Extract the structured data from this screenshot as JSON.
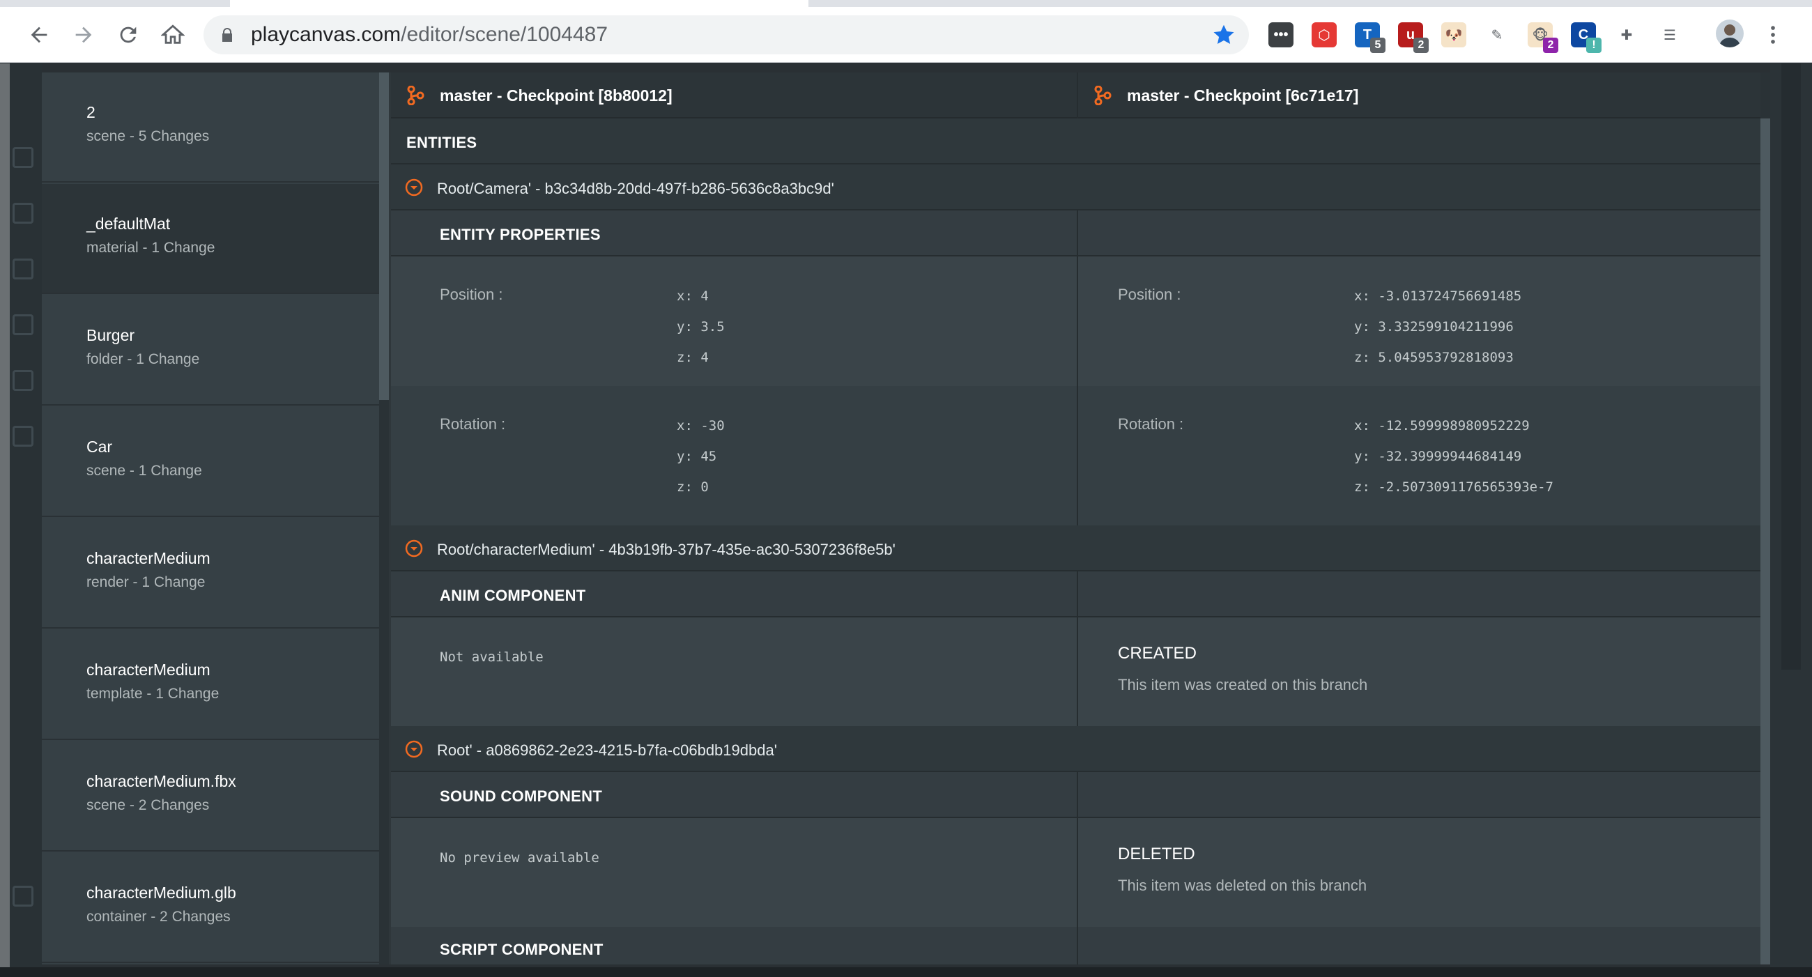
{
  "browser": {
    "url_host": "playcanvas.com",
    "url_path": "/editor/scene/1004487",
    "extensions": [
      {
        "name": "more-dots-extension",
        "color": "#3c4043",
        "glyph": "•••",
        "badge": ""
      },
      {
        "name": "hex-extension",
        "color": "#e53935",
        "glyph": "⬡",
        "badge": ""
      },
      {
        "name": "blue-tag-extension",
        "color": "#1565c0",
        "glyph": "T",
        "badge": "5"
      },
      {
        "name": "ublock-extension",
        "color": "#b71c1c",
        "glyph": "u",
        "badge": "2"
      },
      {
        "name": "dog-face-extension",
        "color": "#f5e3c8",
        "glyph": "🐶",
        "badge": ""
      },
      {
        "name": "pencil-extension",
        "color": "#ffffff",
        "glyph": "✎",
        "badge": ""
      },
      {
        "name": "monkey-extension",
        "color": "#f5e3c8",
        "glyph": "🐵",
        "badge": "2"
      },
      {
        "name": "c-ring-extension",
        "color": "#0d47a1",
        "glyph": "C",
        "badge": "!"
      },
      {
        "name": "puzzle-extension",
        "color": "#ffffff",
        "glyph": "✚",
        "badge": ""
      },
      {
        "name": "reading-list-extension",
        "color": "#ffffff",
        "glyph": "☰",
        "badge": ""
      }
    ]
  },
  "changes": [
    {
      "name": "2",
      "desc": "scene - 5 Changes"
    },
    {
      "name": "_defaultMat",
      "desc": "material - 1 Change"
    },
    {
      "name": "Burger",
      "desc": "folder - 1 Change"
    },
    {
      "name": "Car",
      "desc": "scene - 1 Change"
    },
    {
      "name": "characterMedium",
      "desc": "render - 1 Change"
    },
    {
      "name": "characterMedium",
      "desc": "template - 1 Change"
    },
    {
      "name": "characterMedium.fbx",
      "desc": "scene - 2 Changes"
    },
    {
      "name": "characterMedium.glb",
      "desc": "container - 2 Changes"
    }
  ],
  "diff": {
    "left_header": "master - Checkpoint [8b80012]",
    "right_header": "master - Checkpoint [6c71e17]",
    "entities_label": "ENTITIES",
    "entity1": {
      "path": "Root/Camera' - b3c34d8b-20dd-497f-b286-5636c8a3bc9d'",
      "section": "ENTITY PROPERTIES",
      "position_label": "Position :",
      "rotation_label": "Rotation :",
      "left_position": {
        "x": "x: 4",
        "y": "y: 3.5",
        "z": "z: 4"
      },
      "right_position": {
        "x": "x: -3.013724756691485",
        "y": "y: 3.332599104211996",
        "z": "z: 5.045953792818093"
      },
      "left_rotation": {
        "x": "x: -30",
        "y": "y: 45",
        "z": "z: 0"
      },
      "right_rotation": {
        "x": "x: -12.599998980952229",
        "y": "y: -32.39999944684149",
        "z": "z: -2.5073091176565393e-7"
      }
    },
    "entity2": {
      "path": "Root/characterMedium' - 4b3b19fb-37b7-435e-ac30-5307236f8e5b'",
      "section": "ANIM COMPONENT",
      "left_value": "Not available",
      "right_title": "CREATED",
      "right_desc": "This item was created on this branch"
    },
    "entity3": {
      "path": "Root' - a0869862-2e23-4215-b7fa-c06bdb19dbda'",
      "section": "SOUND COMPONENT",
      "left_value": "No preview available",
      "right_title": "DELETED",
      "right_desc": "This item was deleted on this branch",
      "next_section": "SCRIPT COMPONENT"
    }
  },
  "colors": {
    "accent": "#f26a21",
    "chrome_star": "#1a73e8"
  }
}
